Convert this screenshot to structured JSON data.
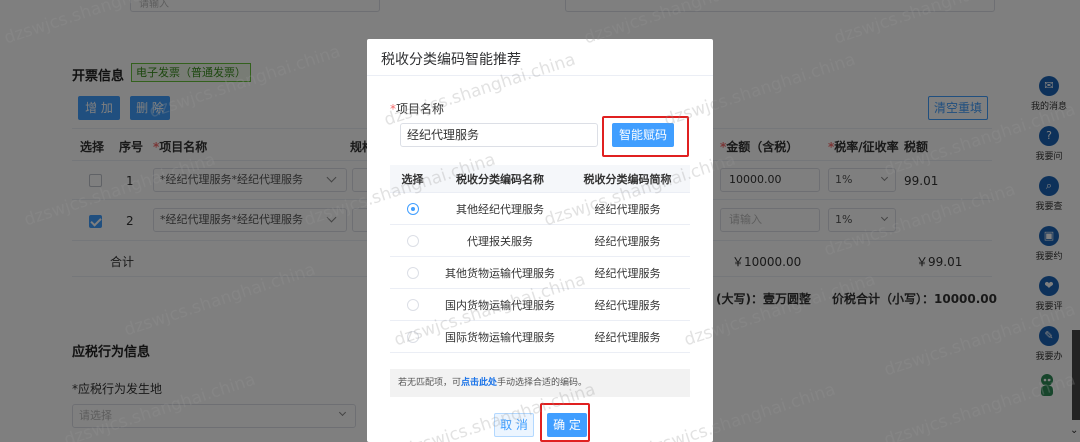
{
  "top": {
    "input_placeholder": "请输入"
  },
  "invoice": {
    "title": "开票信息",
    "tag": "电子发票（普通发票）",
    "add_label": "增 加",
    "delete_label": "删 除",
    "clear_label": "清空重填",
    "columns": {
      "select": "选择",
      "index": "序号",
      "item_name": "项目名称",
      "spec": "规格",
      "amount": "金额（含税）",
      "rate": "税率/征收率",
      "tax": "税额"
    },
    "required_mark": "*",
    "rows": [
      {
        "index": "1",
        "item": "*经纪代理服务*经纪代理服务",
        "amount": "10000.00",
        "rate": "1%",
        "tax": "99.01",
        "checked": false
      },
      {
        "index": "2",
        "item": "*经纪代理服务*经纪代理服务",
        "amount_placeholder": "请输入",
        "rate": "1%",
        "tax": "",
        "checked": true
      }
    ],
    "total_label": "合计",
    "total_amount": "￥10000.00",
    "total_tax": "￥99.01",
    "total_upper": "(大写)：壹万圆整",
    "total_lower": "价税合计（小写）：10000.00"
  },
  "tax_behavior": {
    "title": "应税行为信息",
    "place_label": "*应税行为发生地",
    "place_placeholder": "请选择"
  },
  "rail": [
    {
      "label": "我的消息",
      "icon": "message-icon",
      "glyph": "✉"
    },
    {
      "label": "我要问",
      "icon": "question-icon",
      "glyph": "?"
    },
    {
      "label": "我要查",
      "icon": "search-icon",
      "glyph": "⌕"
    },
    {
      "label": "我要约",
      "icon": "calendar-icon",
      "glyph": "▣"
    },
    {
      "label": "我要评",
      "icon": "rate-icon",
      "glyph": "❤"
    },
    {
      "label": "我要办",
      "icon": "edit-icon",
      "glyph": "✎"
    }
  ],
  "dialog": {
    "title": "税收分类编码智能推荐",
    "required_mark": "*",
    "item_label": "项目名称",
    "item_value": "经纪代理服务",
    "smart_button": "智能赋码",
    "table": {
      "headers": [
        "选择",
        "税收分类编码名称",
        "税收分类编码简称"
      ],
      "rows": [
        {
          "name": "其他经纪代理服务",
          "short": "经纪代理服务",
          "selected": true
        },
        {
          "name": "代理报关服务",
          "short": "经纪代理服务",
          "selected": false
        },
        {
          "name": "其他货物运输代理服务",
          "short": "经纪代理服务",
          "selected": false
        },
        {
          "name": "国内货物运输代理服务",
          "short": "经纪代理服务",
          "selected": false
        },
        {
          "name": "国际货物运输代理服务",
          "short": "经纪代理服务",
          "selected": false
        }
      ]
    },
    "tip_prefix": "若无匹配项，可",
    "tip_link": "点击此处",
    "tip_suffix": "手动选择合适的编码。",
    "cancel": "取 消",
    "confirm": "确 定"
  },
  "watermark": "dzswjcs.shanghai.china"
}
